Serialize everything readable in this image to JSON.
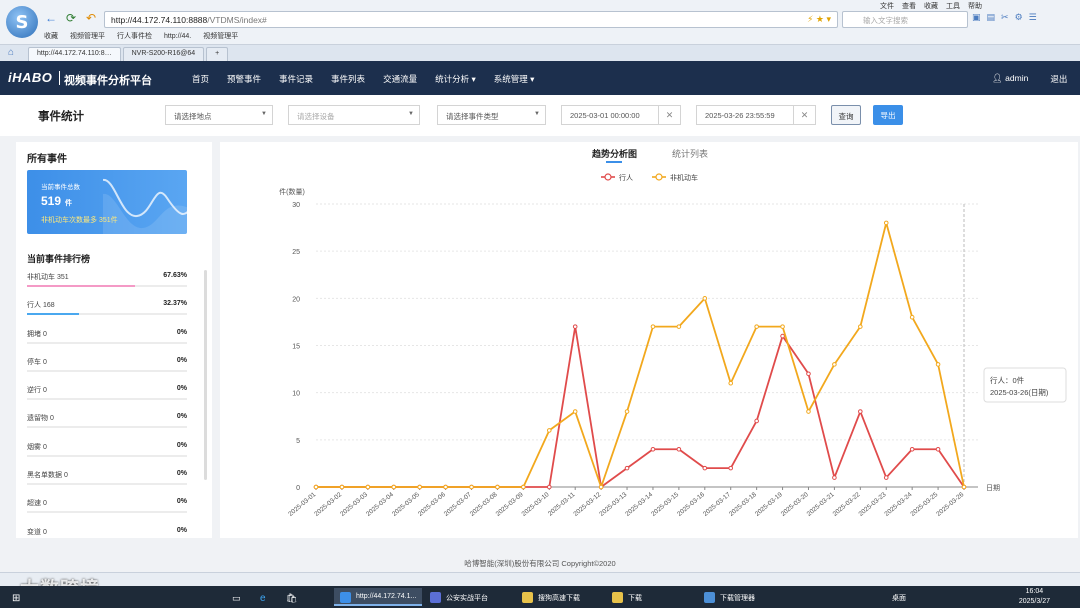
{
  "browser": {
    "url_host": "http://44.172.74.110:8888",
    "url_path": "/VTDMS/index#",
    "search_placeholder": "输入文字搜索",
    "menu": [
      "文件",
      "查看",
      "收藏",
      "工具",
      "帮助"
    ],
    "favorites": [
      "收藏",
      "视频管理平",
      "行人事件检",
      "http://44.",
      "视频管理平"
    ],
    "tabs": [
      "http://44.172.74.110:8…",
      "NVR-S200-R16@64"
    ]
  },
  "app": {
    "brand": "iHABO",
    "title": "视频事件分析平台",
    "nav": [
      "首页",
      "预警事件",
      "事件记录",
      "事件列表",
      "交通流量",
      "统计分析 ▾",
      "系统管理 ▾"
    ],
    "user": "admin",
    "logout": "退出"
  },
  "filters": {
    "page_title": "事件统计",
    "location_placeholder": "请选择地点",
    "device_placeholder": "请选择设备",
    "event_type_placeholder": "请选择事件类型",
    "start_time": "2025-03-01 00:00:00",
    "end_time": "2025-03-26 23:55:59",
    "query_label": "查询",
    "export_label": "导出"
  },
  "summary": {
    "title": "所有事件",
    "total_label": "当前事件总数",
    "total_value": "519",
    "total_unit": "件",
    "most_text": "非机动车次数最多  351件",
    "rank_title": "当前事件排行榜",
    "ranking": [
      {
        "name": "非机动车  351",
        "pct": "67.63%",
        "fill": 0.6763,
        "color": "#f49ac6"
      },
      {
        "name": "行人  168",
        "pct": "32.37%",
        "fill": 0.3237,
        "color": "#4aa8ef"
      },
      {
        "name": "拥堵  0",
        "pct": "0%",
        "fill": 0,
        "color": "#cccccc"
      },
      {
        "name": "停车  0",
        "pct": "0%",
        "fill": 0,
        "color": "#cccccc"
      },
      {
        "name": "逆行  0",
        "pct": "0%",
        "fill": 0,
        "color": "#cccccc"
      },
      {
        "name": "遗留物  0",
        "pct": "0%",
        "fill": 0,
        "color": "#cccccc"
      },
      {
        "name": "烟雾  0",
        "pct": "0%",
        "fill": 0,
        "color": "#cccccc"
      },
      {
        "name": "黑名单数据  0",
        "pct": "0%",
        "fill": 0,
        "color": "#cccccc"
      },
      {
        "name": "超速  0",
        "pct": "0%",
        "fill": 0,
        "color": "#cccccc"
      },
      {
        "name": "变道  0",
        "pct": "0%",
        "fill": 0,
        "color": "#cccccc"
      }
    ]
  },
  "chart_tabs": [
    "趋势分析图",
    "统计列表"
  ],
  "chart_data": {
    "type": "line",
    "title": "",
    "ylabel": "件(数量)",
    "xlabel": "日期",
    "ylim": [
      0,
      30
    ],
    "yticks": [
      0,
      5,
      10,
      15,
      20,
      25,
      30
    ],
    "grid": true,
    "legend": "top-center",
    "categories": [
      "2025-03-01",
      "2025-03-02",
      "2025-03-03",
      "2025-03-04",
      "2025-03-05",
      "2025-03-06",
      "2025-03-07",
      "2025-03-08",
      "2025-03-09",
      "2025-03-10",
      "2025-03-11",
      "2025-03-12",
      "2025-03-13",
      "2025-03-14",
      "2025-03-15",
      "2025-03-16",
      "2025-03-17",
      "2025-03-18",
      "2025-03-19",
      "2025-03-20",
      "2025-03-21",
      "2025-03-22",
      "2025-03-23",
      "2025-03-24",
      "2025-03-25",
      "2025-03-26"
    ],
    "series": [
      {
        "name": "行人",
        "color": "#e04b4b",
        "values": [
          0,
          0,
          0,
          0,
          0,
          0,
          0,
          0,
          0,
          0,
          17,
          0,
          2,
          4,
          4,
          2,
          2,
          7,
          16,
          12,
          1,
          8,
          1,
          4,
          4,
          0
        ]
      },
      {
        "name": "非机动车",
        "color": "#f2a81d",
        "values": [
          0,
          0,
          0,
          0,
          0,
          0,
          0,
          0,
          0,
          6,
          8,
          0,
          8,
          17,
          17,
          20,
          11,
          17,
          17,
          8,
          13,
          17,
          28,
          18,
          13,
          0
        ]
      }
    ],
    "tooltip": [
      "行人：0件",
      "2025-03-26(日期)"
    ]
  },
  "footer": "哈博智能(深圳)股份有限公司 Copyright©2020",
  "watermark": "大数跨境",
  "taskbar": {
    "items": [
      "http://44.172.74.1...",
      "公安实战平台",
      "搜狗高速下载",
      "下载",
      "下载管理器"
    ],
    "desktop": "桌面",
    "time": "16:04",
    "date": "2025/3/27"
  }
}
